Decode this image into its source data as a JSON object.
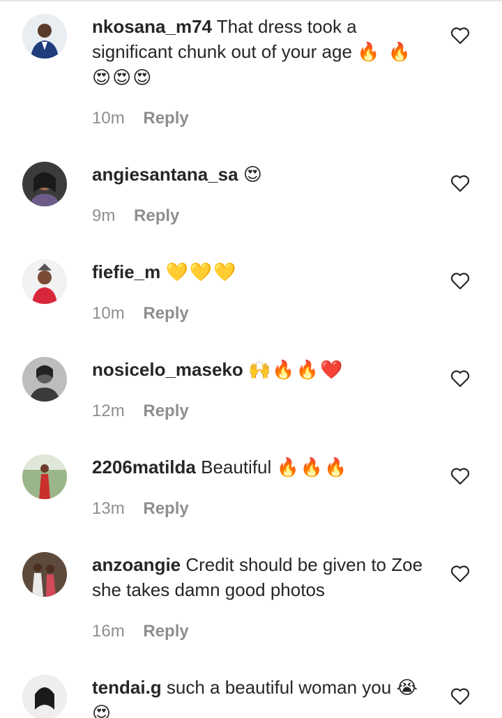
{
  "comments": [
    {
      "username": "nkosana_m74",
      "text": "That dress took a significant chunk out of your age",
      "emojis": "🔥 🔥 😍😍😍",
      "time": "10m",
      "reply": "Reply"
    },
    {
      "username": "angiesantana_sa",
      "text": "",
      "emojis": "😍",
      "time": "9m",
      "reply": "Reply"
    },
    {
      "username": "fiefie_m",
      "text": "",
      "emojis": "💛💛💛",
      "time": "10m",
      "reply": "Reply"
    },
    {
      "username": "nosicelo_maseko",
      "text": "",
      "emojis": "🙌🔥🔥❤️",
      "time": "12m",
      "reply": "Reply"
    },
    {
      "username": "2206matilda",
      "text": "Beautiful",
      "emojis": "🔥🔥🔥",
      "time": "13m",
      "reply": "Reply"
    },
    {
      "username": "anzoangie",
      "text": "Credit should be given to Zoe she takes damn good photos",
      "emojis": "",
      "time": "16m",
      "reply": "Reply"
    },
    {
      "username": "tendai.g",
      "text": "such a beautiful woman you",
      "emojis": "😭😍",
      "time": "",
      "reply": ""
    }
  ],
  "icons": {
    "like": "heart-outline-icon"
  },
  "colors": {
    "text": "#262626",
    "meta": "#8e8e8e",
    "background": "#ffffff"
  }
}
